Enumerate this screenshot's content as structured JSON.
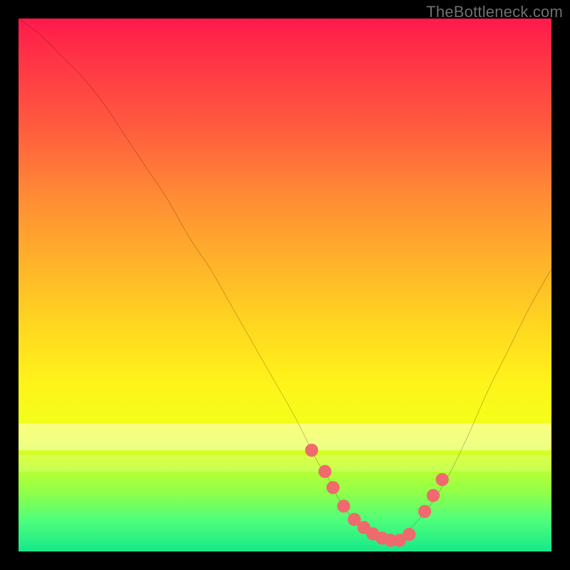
{
  "watermark": "TheBottleneck.com",
  "colors": {
    "frame": "#000000",
    "curve": "#000000",
    "marker_fill": "#ef6a6d",
    "marker_stroke": "#ef6a6d"
  },
  "chart_data": {
    "type": "line",
    "title": "",
    "xlabel": "",
    "ylabel": "",
    "xlim": [
      0,
      100
    ],
    "ylim": [
      0,
      100
    ],
    "series": [
      {
        "name": "bottleneck-curve",
        "x": [
          0,
          4,
          8,
          12,
          16,
          20,
          24,
          28,
          32,
          36,
          40,
          44,
          48,
          52,
          56,
          58,
          60,
          62,
          64,
          66,
          68,
          70,
          72,
          76,
          80,
          84,
          88,
          92,
          96,
          100
        ],
        "y": [
          100,
          97,
          93,
          89,
          84,
          78,
          72,
          66,
          59,
          53,
          46,
          39,
          32,
          25,
          17,
          14,
          10,
          7,
          5,
          3,
          2,
          2,
          3,
          7,
          13,
          21,
          30,
          38,
          46,
          53
        ]
      }
    ],
    "markers": {
      "name": "highlight-points",
      "x": [
        55,
        57.5,
        59,
        61,
        63,
        64.8,
        66.5,
        68.2,
        69.8,
        71.5,
        73.3,
        76.2,
        77.8,
        79.5
      ],
      "y": [
        19,
        15,
        12,
        8.5,
        6,
        4.5,
        3.3,
        2.5,
        2.1,
        2.1,
        3.2,
        7.5,
        10.5,
        13.5
      ]
    }
  }
}
